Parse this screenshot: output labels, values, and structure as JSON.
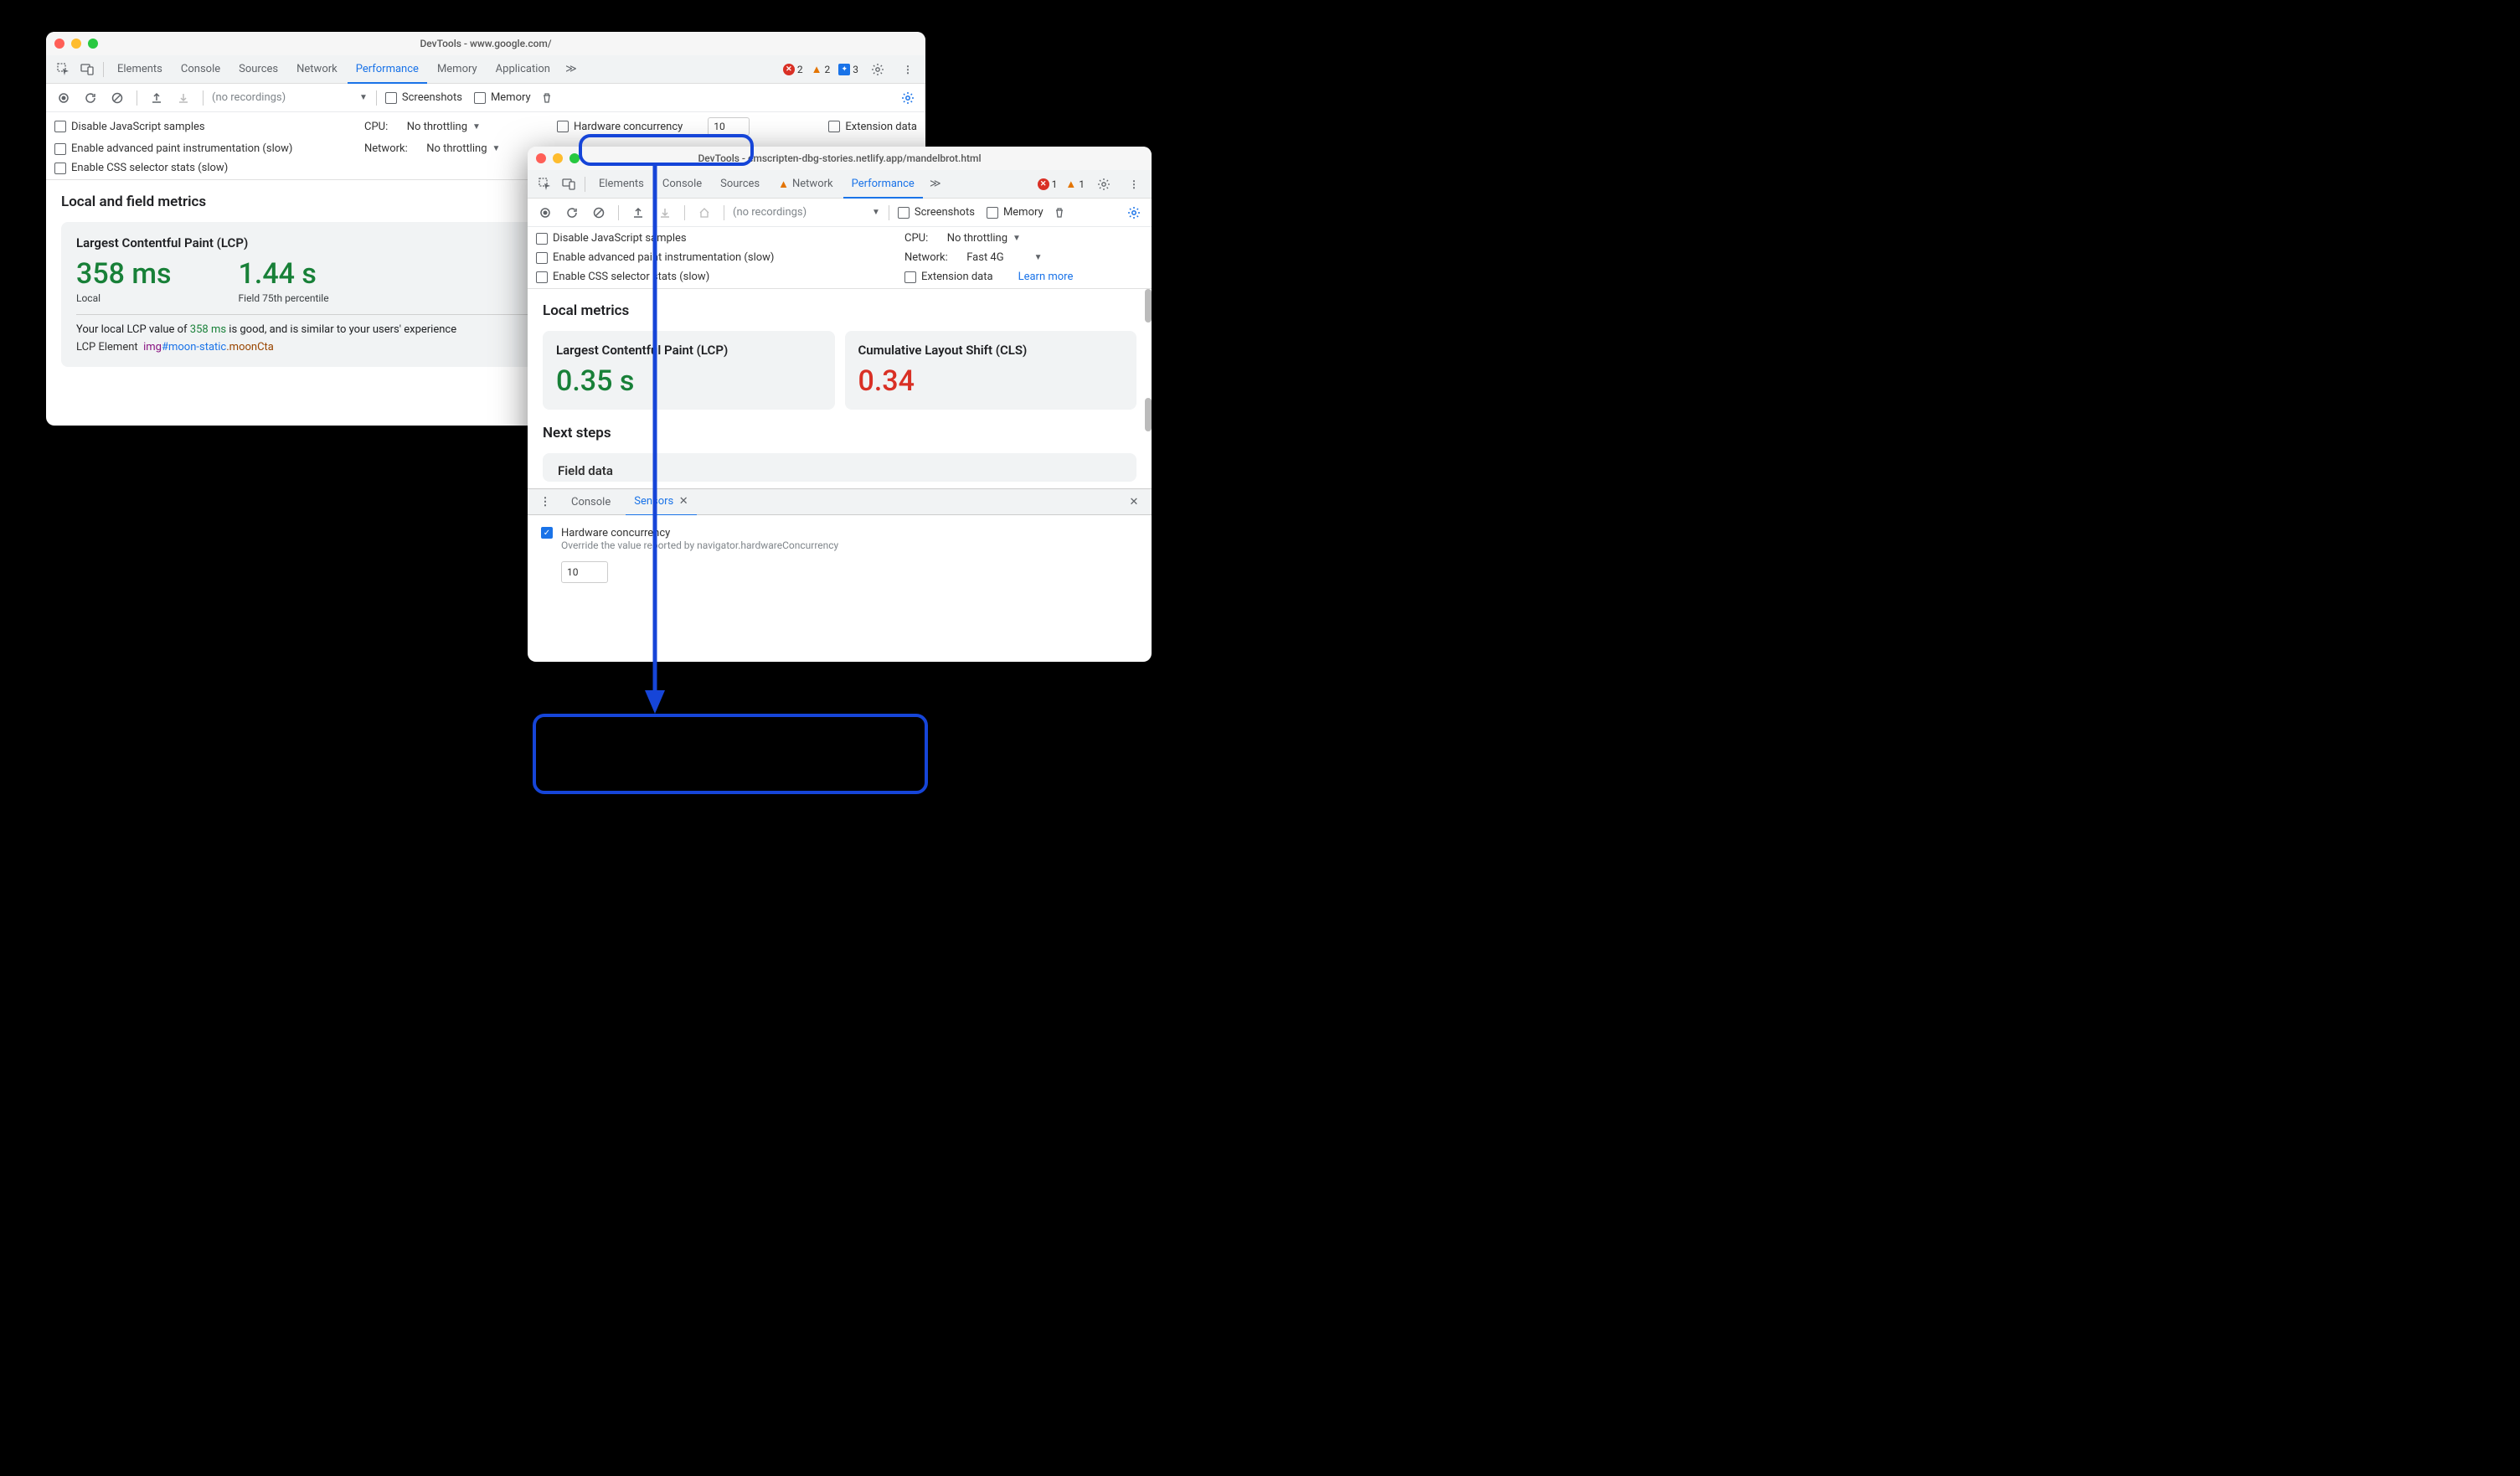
{
  "win1": {
    "title": "DevTools - www.google.com/",
    "tabs": [
      "Elements",
      "Console",
      "Sources",
      "Network",
      "Performance",
      "Memory",
      "Application"
    ],
    "active_tab": "Performance",
    "status": {
      "errors": "2",
      "warnings": "2",
      "info": "3"
    },
    "recordings_placeholder": "(no recordings)",
    "screenshots_label": "Screenshots",
    "memory_label": "Memory",
    "settings": {
      "disable_js": "Disable JavaScript samples",
      "paint_instr": "Enable advanced paint instrumentation (slow)",
      "css_stats": "Enable CSS selector stats (slow)",
      "cpu_label": "CPU:",
      "cpu_value": "No throttling",
      "network_label": "Network:",
      "network_value": "No throttling",
      "hw_label": "Hardware concurrency",
      "hw_value": "10",
      "ext_label": "Extension data"
    },
    "metrics": {
      "heading": "Local and field metrics",
      "lcp_title": "Largest Contentful Paint (LCP)",
      "local_val": "358 ms",
      "local_sub": "Local",
      "field_val": "1.44 s",
      "field_sub": "Field 75th percentile",
      "desc_pre": "Your local LCP value of ",
      "desc_val": "358 ms",
      "desc_post": " is good, and is similar to your users' experience",
      "lcp_el_label": "LCP Element",
      "lcp_tag": "img",
      "lcp_id": "#moon-static",
      "lcp_cls": ".moonCta"
    }
  },
  "win2": {
    "title": "DevTools - emscripten-dbg-stories.netlify.app/mandelbrot.html",
    "tabs": [
      "Elements",
      "Console",
      "Sources",
      "Network",
      "Performance"
    ],
    "network_has_warn": true,
    "active_tab": "Performance",
    "status": {
      "errors": "1",
      "warnings": "1"
    },
    "recordings_placeholder": "(no recordings)",
    "screenshots_label": "Screenshots",
    "memory_label": "Memory",
    "settings": {
      "disable_js": "Disable JavaScript samples",
      "paint_instr": "Enable advanced paint instrumentation (slow)",
      "css_stats": "Enable CSS selector stats (slow)",
      "cpu_label": "CPU:",
      "cpu_value": "No throttling",
      "network_label": "Network:",
      "network_value": "Fast 4G",
      "ext_label": "Extension data",
      "learn_more": "Learn more"
    },
    "metrics": {
      "heading": "Local metrics",
      "lcp_title": "Largest Contentful Paint (LCP)",
      "lcp_val": "0.35 s",
      "cls_title": "Cumulative Layout Shift (CLS)",
      "cls_val": "0.34",
      "next_heading": "Next steps",
      "field_heading": "Field data"
    },
    "drawer": {
      "tab_console": "Console",
      "tab_sensors": "Sensors",
      "hw_label": "Hardware concurrency",
      "hw_desc": "Override the value reported by navigator.hardwareConcurrency",
      "hw_value": "10"
    }
  }
}
